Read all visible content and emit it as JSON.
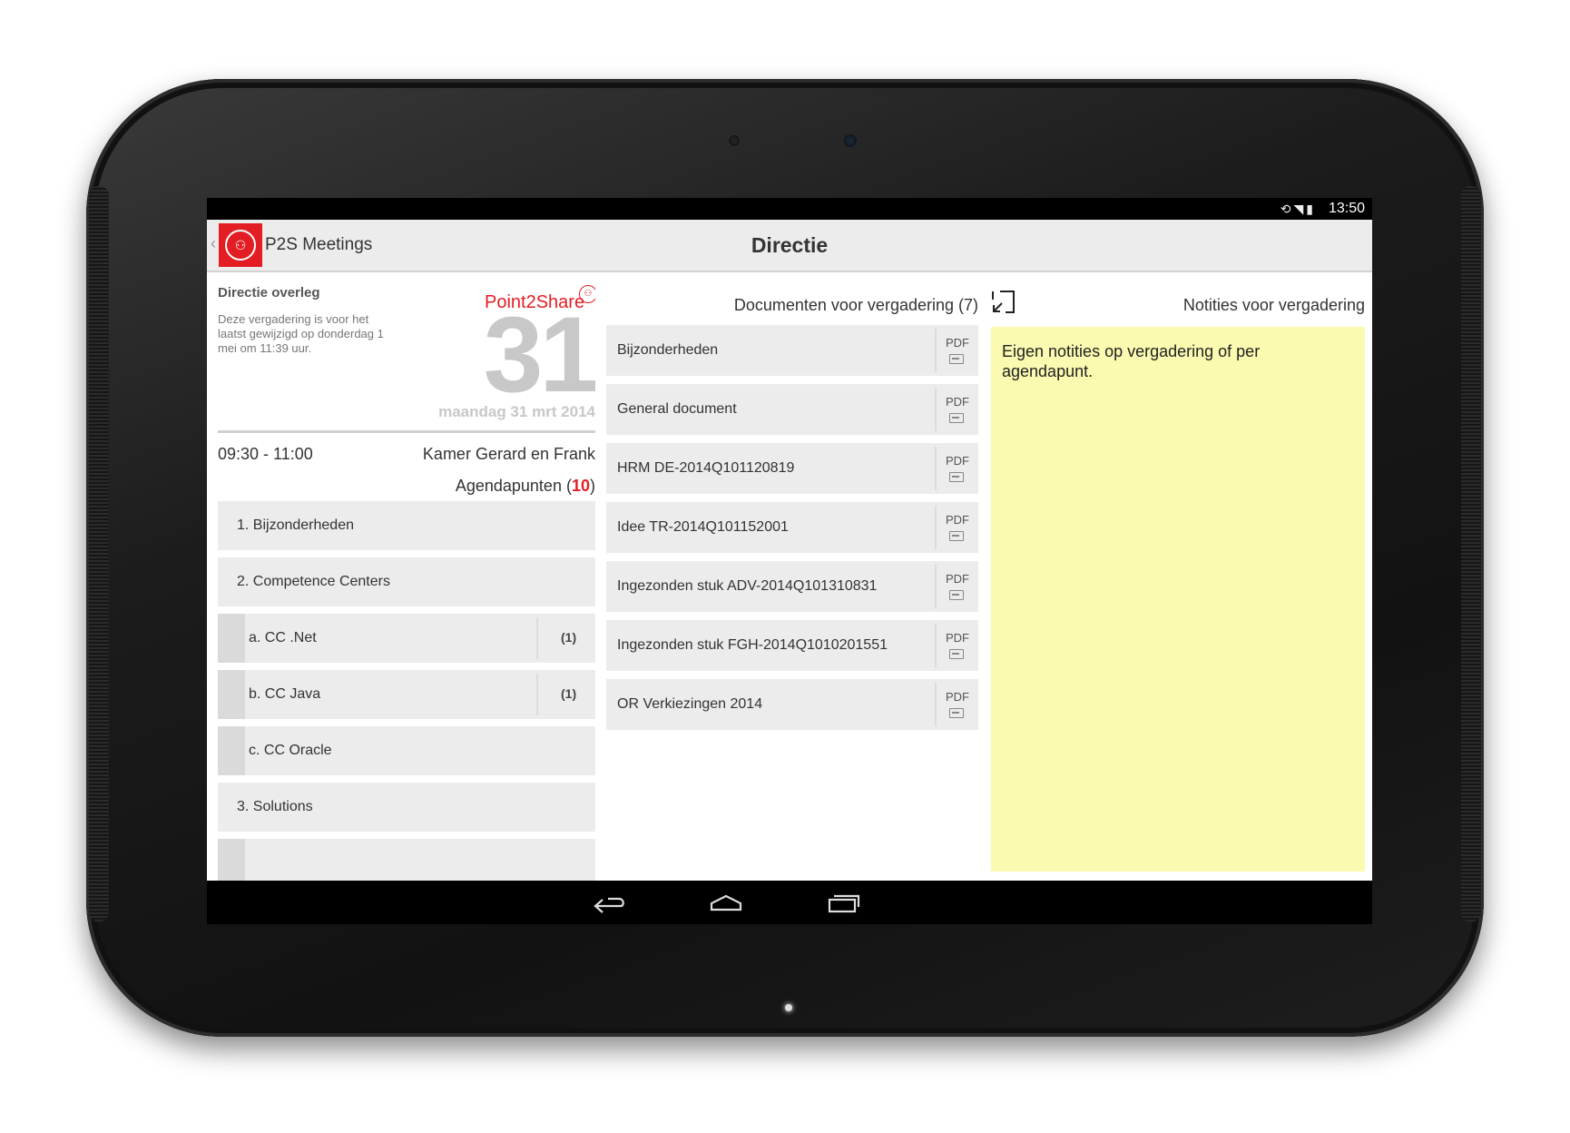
{
  "status_bar": {
    "time": "13:50",
    "icons": [
      "rotate-icon",
      "wifi-icon",
      "battery-icon"
    ]
  },
  "action_bar": {
    "app_name": "P2S Meetings",
    "title": "Directie"
  },
  "meeting": {
    "title": "Directie overleg",
    "description": "Deze vergadering is voor het laatst gewijzigd op donderdag 1 mei om 11:39 uur.",
    "brand": "Point2Share",
    "day_number": "31",
    "date_full": "maandag 31 mrt 2014",
    "time_range": "09:30 - 11:00",
    "room": "Kamer Gerard en Frank",
    "agenda_label": "Agendapunten",
    "agenda_count": "10"
  },
  "agenda": [
    {
      "label": "1.  Bijzonderheden",
      "count": ""
    },
    {
      "label": "2.  Competence Centers",
      "count": ""
    },
    {
      "label": "a.  CC .Net",
      "count": "(1)"
    },
    {
      "label": "b.  CC Java",
      "count": "(1)"
    },
    {
      "label": "c.  CC Oracle",
      "count": ""
    },
    {
      "label": "3.  Solutions",
      "count": ""
    }
  ],
  "documents": {
    "header": "Documenten voor vergadering (7)",
    "items": [
      {
        "name": "Bijzonderheden",
        "type": "PDF"
      },
      {
        "name": "General document",
        "type": "PDF"
      },
      {
        "name": "HRM DE-2014Q101120819",
        "type": "PDF"
      },
      {
        "name": "Idee TR-2014Q101152001",
        "type": "PDF"
      },
      {
        "name": "Ingezonden stuk ADV-2014Q101310831",
        "type": "PDF"
      },
      {
        "name": "Ingezonden stuk FGH-2014Q1010201551",
        "type": "PDF"
      },
      {
        "name": "OR Verkiezingen 2014",
        "type": "PDF"
      }
    ]
  },
  "notes": {
    "header": "Notities voor vergadering",
    "text": "Eigen notities op vergadering of per agendapunt."
  },
  "colors": {
    "accent": "#e31d24",
    "notes_bg": "#fafab0",
    "item_bg": "#ececec"
  }
}
